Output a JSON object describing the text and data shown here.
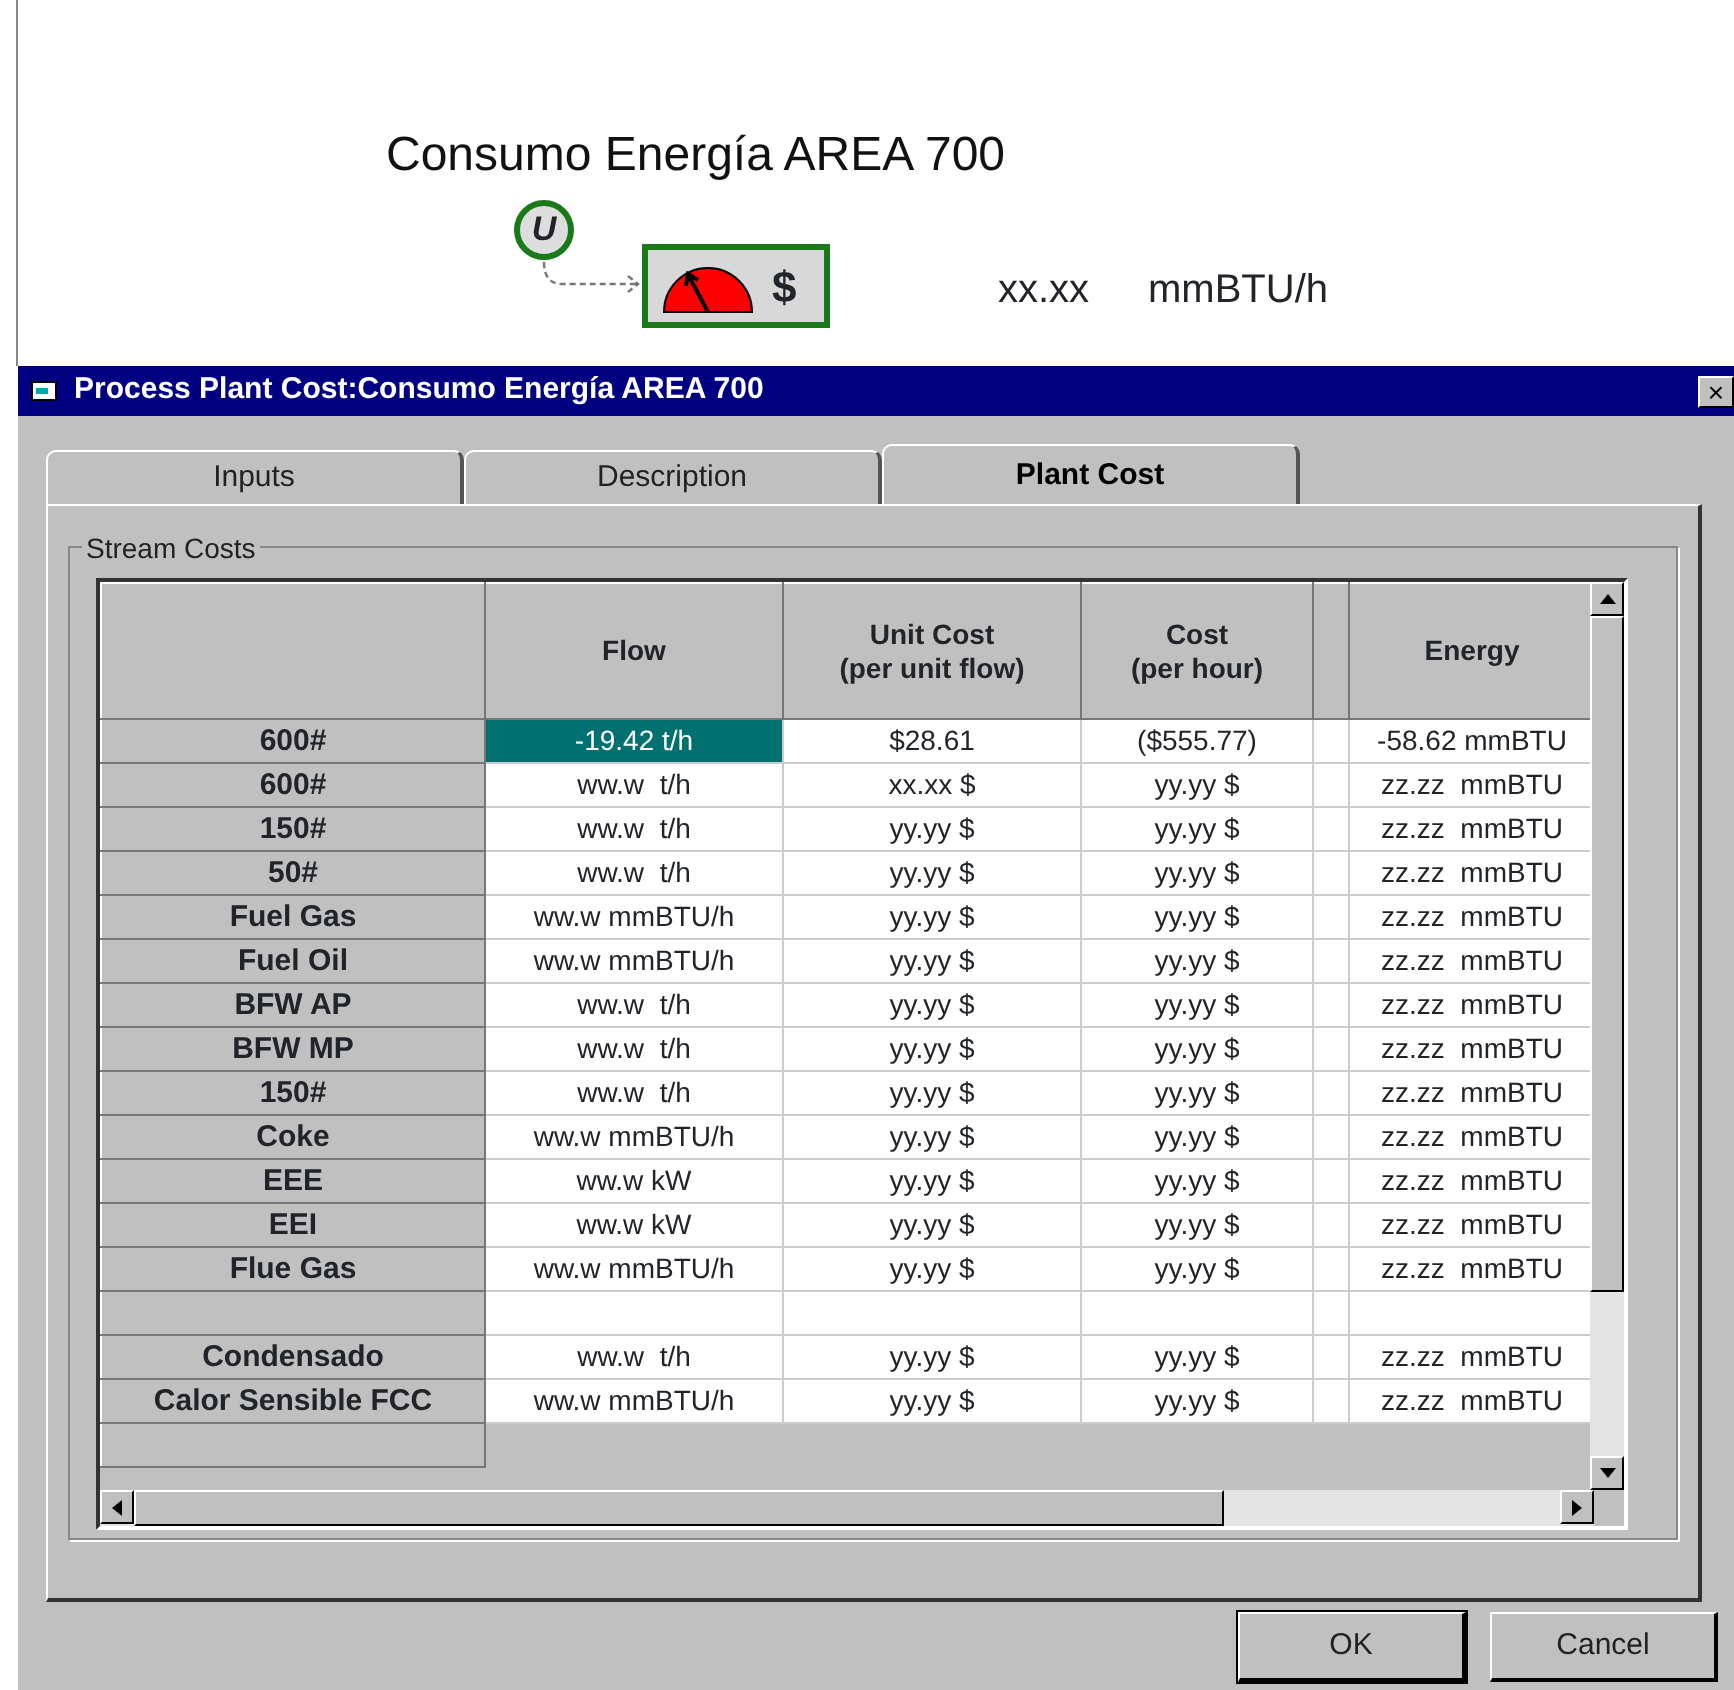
{
  "canvas": {
    "title": "Consumo Energía AREA 700",
    "input_symbol": "U",
    "block_symbol": "$",
    "reading": "xx.xx",
    "unit": "mmBTU/h"
  },
  "dialog": {
    "title": "Process Plant Cost:Consumo Energía AREA 700",
    "close": "×"
  },
  "tabs": [
    {
      "label": "Inputs",
      "selected": false
    },
    {
      "label": "Description",
      "selected": false
    },
    {
      "label": "Plant Cost",
      "selected": true
    }
  ],
  "group": {
    "label": "Stream Costs"
  },
  "table": {
    "columns": [
      {
        "lines": [
          "Flow"
        ]
      },
      {
        "lines": [
          "Unit Cost",
          "(per unit flow)"
        ]
      },
      {
        "lines": [
          "Cost",
          "(per hour)"
        ]
      },
      {
        "lines": [
          "Energy"
        ]
      }
    ],
    "rows": [
      {
        "kind": "data",
        "name": "600#",
        "flow": "-19.42 t/h",
        "unit_cost": "$28.61",
        "cost": "($555.77)",
        "energy": "-58.62 mmBTU",
        "selected": true
      },
      {
        "kind": "data",
        "name": "600#",
        "flow": "ww.w  t/h",
        "unit_cost": "xx.xx $",
        "cost": "yy.yy $",
        "energy": "zz.zz  mmBTU",
        "selected": false
      },
      {
        "kind": "data",
        "name": "150#",
        "flow": "ww.w  t/h",
        "unit_cost": "yy.yy $",
        "cost": "yy.yy $",
        "energy": "zz.zz  mmBTU",
        "selected": false
      },
      {
        "kind": "data",
        "name": "50#",
        "flow": "ww.w  t/h",
        "unit_cost": "yy.yy $",
        "cost": "yy.yy $",
        "energy": "zz.zz  mmBTU",
        "selected": false
      },
      {
        "kind": "data",
        "name": "Fuel Gas",
        "flow": "ww.w mmBTU/h",
        "unit_cost": "yy.yy $",
        "cost": "yy.yy $",
        "energy": "zz.zz  mmBTU",
        "selected": false
      },
      {
        "kind": "data",
        "name": "Fuel Oil",
        "flow": "ww.w mmBTU/h",
        "unit_cost": "yy.yy $",
        "cost": "yy.yy $",
        "energy": "zz.zz  mmBTU",
        "selected": false
      },
      {
        "kind": "data",
        "name": "BFW AP",
        "flow": "ww.w  t/h",
        "unit_cost": "yy.yy $",
        "cost": "yy.yy $",
        "energy": "zz.zz  mmBTU",
        "selected": false
      },
      {
        "kind": "data",
        "name": "BFW MP",
        "flow": "ww.w  t/h",
        "unit_cost": "yy.yy $",
        "cost": "yy.yy $",
        "energy": "zz.zz  mmBTU",
        "selected": false
      },
      {
        "kind": "data",
        "name": "150#",
        "flow": "ww.w  t/h",
        "unit_cost": "yy.yy $",
        "cost": "yy.yy $",
        "energy": "zz.zz  mmBTU",
        "selected": false
      },
      {
        "kind": "data",
        "name": "Coke",
        "flow": "ww.w mmBTU/h",
        "unit_cost": "yy.yy $",
        "cost": "yy.yy $",
        "energy": "zz.zz  mmBTU",
        "selected": false
      },
      {
        "kind": "data",
        "name": "EEE",
        "flow": "ww.w kW",
        "unit_cost": "yy.yy $",
        "cost": "yy.yy $",
        "energy": "zz.zz  mmBTU",
        "selected": false
      },
      {
        "kind": "data",
        "name": "EEI",
        "flow": "ww.w kW",
        "unit_cost": "yy.yy $",
        "cost": "yy.yy $",
        "energy": "zz.zz  mmBTU",
        "selected": false
      },
      {
        "kind": "data",
        "name": "Flue Gas",
        "flow": "ww.w mmBTU/h",
        "unit_cost": "yy.yy $",
        "cost": "yy.yy $",
        "energy": "zz.zz  mmBTU",
        "selected": false
      },
      {
        "kind": "blank",
        "selected": false
      },
      {
        "kind": "data",
        "name": "Condensado",
        "flow": "ww.w  t/h",
        "unit_cost": "yy.yy $",
        "cost": "yy.yy $",
        "energy": "zz.zz  mmBTU",
        "selected": false
      },
      {
        "kind": "data",
        "name": "Calor Sensible FCC",
        "flow": "ww.w mmBTU/h",
        "unit_cost": "yy.yy $",
        "cost": "yy.yy $",
        "energy": "zz.zz  mmBTU",
        "selected": false
      }
    ]
  },
  "buttons": [
    "OK",
    "Cancel"
  ]
}
